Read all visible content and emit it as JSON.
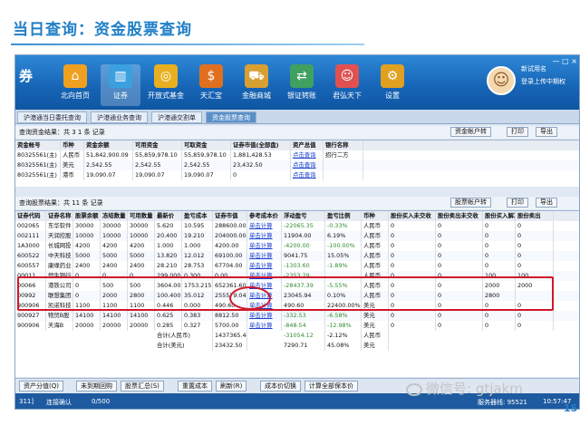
{
  "slide": {
    "title": "当日查询：资金股票查询",
    "page_number": "15",
    "watermark": "微信号: gtjakm"
  },
  "app": {
    "logo": "券",
    "toolbar": [
      {
        "label": "北向首页",
        "icon": "home-icon",
        "glyph": "⌂",
        "color": "#f0a020"
      },
      {
        "label": "证券",
        "icon": "chart-icon",
        "glyph": "▥",
        "color": "#3aa0e0",
        "active": true
      },
      {
        "label": "开放式基金",
        "icon": "coins-icon",
        "glyph": "◎",
        "color": "#e8b020"
      },
      {
        "label": "天汇宝",
        "icon": "dollar-icon",
        "glyph": "$",
        "color": "#e07020"
      },
      {
        "label": "金融商城",
        "icon": "cart-icon",
        "glyph": "⛟",
        "color": "#d8a030"
      },
      {
        "label": "银证转账",
        "icon": "transfer-icon",
        "glyph": "⇄",
        "color": "#40a060"
      },
      {
        "label": "君弘天下",
        "icon": "people-icon",
        "glyph": "☺",
        "color": "#e05050"
      },
      {
        "label": "设置",
        "icon": "gear-icon",
        "glyph": "⚙",
        "color": "#e0a020"
      }
    ],
    "user": {
      "name": "新试用名",
      "info": "登录上传中期权",
      "window_controls": "— □ ×"
    },
    "tabs": [
      "沪港通当日委托查询",
      "沪港通业务查询",
      "沪港通交割单",
      "资金股票查询"
    ],
    "funds_section": {
      "summary": "查询资金结果：共 3 1 条 记录",
      "buttons": [
        "资金帐户转",
        "打印",
        "导出"
      ],
      "headers": [
        "资金帐号",
        "币种",
        "资金余额",
        "可用资金",
        "可取资金",
        "证券市值(全部盘)",
        "资产总值",
        "银行名称"
      ],
      "rows": [
        [
          "80325561(主)",
          "人民币",
          "51,842,900.09",
          "55,859,978.10",
          "55,859,978.10",
          "1,881,428.53",
          "点击查询",
          "招行二方"
        ],
        [
          "80325561(主)",
          "美元",
          "2,542.55",
          "2,542.55",
          "2,542.55",
          "23,432.50",
          "点击查询",
          ""
        ],
        [
          "80325561(主)",
          "港币",
          "19,090.07",
          "19,090.07",
          "19,090.07",
          "0",
          "点击查询",
          ""
        ]
      ]
    },
    "stock_section": {
      "summary": "查询股票结果：共 11 条 记录",
      "buttons": [
        "股票帐户转",
        "打印",
        "导出"
      ],
      "headers": [
        "证券代码",
        "证券名称",
        "股票余额",
        "冻结数量",
        "可用数量",
        "最新价",
        "盈亏成本",
        "证券市值",
        "参考成本价",
        "浮动盈亏",
        "盈亏比例",
        "币种",
        "股份买入未交收",
        "股份卖出未交收",
        "股份买入解冻",
        "股份卖出"
      ],
      "rows": [
        [
          "002065",
          "东华软件",
          "30000",
          "30000",
          "30000",
          "5.620",
          "10.595",
          "288600.00",
          "单击计算",
          "-22065.35",
          "-0.33%",
          "人民币",
          "0",
          "0",
          "0",
          "0"
        ],
        [
          "002111",
          "天润控股",
          "10000",
          "10000",
          "10000",
          "20.400",
          "19.210",
          "204000.00",
          "单击计算",
          "11904.00",
          "6.19%",
          "人民币",
          "0",
          "0",
          "0",
          "0"
        ],
        [
          "1A3000",
          "长城网投",
          "4200",
          "4200",
          "4200",
          "1.000",
          "1.000",
          "4200.00",
          "单击计算",
          "-4200.00",
          "-100.00%",
          "人民币",
          "0",
          "0",
          "0",
          "0"
        ],
        [
          "600522",
          "中天科技",
          "5000",
          "5000",
          "5000",
          "13.820",
          "12.012",
          "69100.00",
          "单击计算",
          "9041.75",
          "15.05%",
          "人民币",
          "0",
          "0",
          "0",
          "0"
        ],
        [
          "600557",
          "康缘药业",
          "2400",
          "2400",
          "2400",
          "28.210",
          "28.753",
          "67704.00",
          "单击计算",
          "-1303.60",
          "-1.89%",
          "人民币",
          "0",
          "0",
          "0",
          "0"
        ],
        [
          "00011",
          "恒生银行",
          "0",
          "0",
          "0",
          "299.000",
          "0.300",
          "0.00",
          "单击计算",
          "-2353.29",
          "",
          "人民币",
          "0",
          "0",
          "100",
          "100"
        ],
        [
          "00066",
          "港铁公司",
          "0",
          "500",
          "500",
          "3604.00",
          "1753.215",
          "652361.60",
          "单击计算",
          "-28437.39",
          "-5.55%",
          "人民币",
          "0",
          "0",
          "2000",
          "2000"
        ],
        [
          "00992",
          "联想集团",
          "0",
          "2000",
          "2800",
          "100.400",
          "35.012",
          "255579.04",
          "单击计算",
          "23045.94",
          "0.10%",
          "人民币",
          "0",
          "0",
          "2800",
          ""
        ],
        [
          "900906",
          "凯诺科技",
          "1100",
          "1100",
          "1100",
          "0.446",
          "0.000",
          "490.60",
          "单击计算",
          "490.60",
          "22400.00%",
          "美元",
          "0",
          "0",
          "0",
          "0"
        ],
        [
          "900927",
          "物贸B股",
          "14100",
          "14100",
          "14100",
          "0.625",
          "0.383",
          "8812.50",
          "单击计算",
          "-332.53",
          "-6.58%",
          "美元",
          "0",
          "0",
          "0",
          "0"
        ],
        [
          "900906",
          "天海B",
          "20000",
          "20000",
          "20000",
          "0.285",
          "0.327",
          "5700.00",
          "单击计算",
          "-848.54",
          "-12.98%",
          "美元",
          "0",
          "0",
          "0",
          "0"
        ]
      ],
      "totals": [
        {
          "label": "合计(人民币)",
          "market_value": "1437365.44",
          "pnl": "-31054.12",
          "ratio": "-2.12%",
          "currency": "人民币"
        },
        {
          "label": "合计(美元)",
          "market_value": "23432.50",
          "pnl": "7290.71",
          "ratio": "45.08%",
          "currency": "美元"
        }
      ]
    },
    "bottom_buttons": [
      "资产分值(Q)",
      "未到期回购",
      "股票汇总(S)",
      "重置成本",
      "刷新(R)",
      "成本价切换",
      "计算全部保本价"
    ],
    "status": {
      "left": "311]",
      "connection": "连接确认",
      "count": "0/500",
      "server": "服务器线: 95521",
      "time": "10:57:47"
    }
  }
}
